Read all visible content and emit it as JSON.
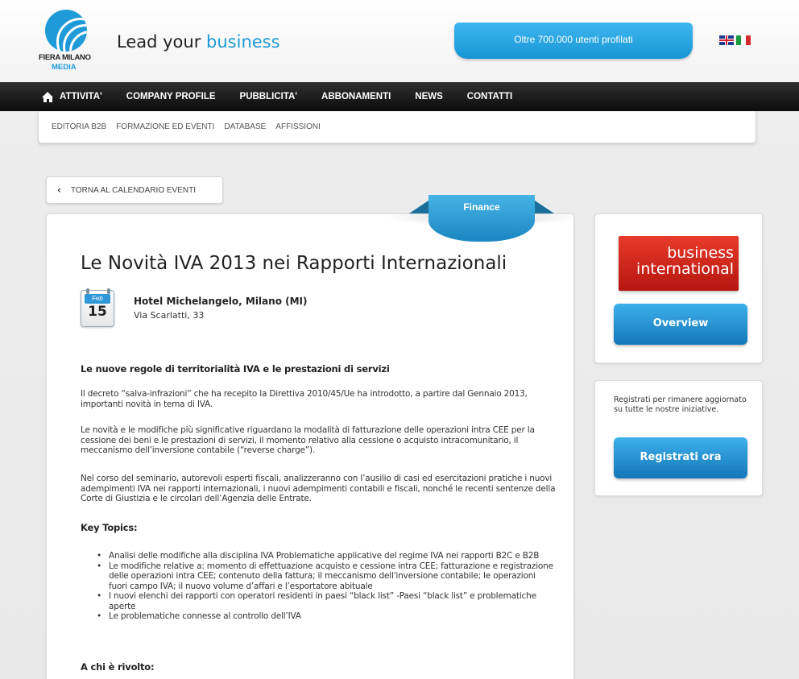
{
  "header": {
    "logo_line1": "FIERA MILANO",
    "logo_line2": "MEDIA",
    "tagline_main": "Lead your ",
    "tagline_accent": "business",
    "users_banner": "Oltre 700.000 utenti profilati",
    "languages": [
      "en-flag",
      "it-flag"
    ]
  },
  "nav": {
    "items": [
      "ATTIVITA'",
      "COMPANY PROFILE",
      "PUBBLICITA'",
      "ABBONAMENTI",
      "NEWS",
      "CONTATTI"
    ]
  },
  "subnav": {
    "items": [
      "EDITORIA B2B",
      "FORMAZIONE ED EVENTI",
      "DATABASE",
      "AFFISSIONI"
    ]
  },
  "back_button": "TORNA AL CALENDARIO EVENTI",
  "event": {
    "category": "Finance",
    "title": "Le Novità IVA 2013 nei Rapporti Internazionali",
    "month": "Feb",
    "day": "15",
    "venue": "Hotel Michelangelo, Milano (MI)",
    "address": "Via Scarlatti, 33"
  },
  "content": {
    "heading1": "Le nuove regole di territorialità IVA e le prestazioni di servizi",
    "para1": "Il decreto “salva-infrazioni” che ha recepito la Direttiva 2010/45/Ue ha introdotto, a partire dal Gennaio 2013, importanti novità in tema di IVA.",
    "para2": "Le novità e le modifiche più significative riguardano la modalità di fatturazione delle operazioni intra CEE per la cessione dei beni e le prestazioni di servizi, il momento relativo alla cessione o acquisto intracomunitario, il meccanismo dell’inversione contabile (“reverse charge”).",
    "para3": "Nel corso del seminario, autorevoli esperti fiscali, analizzeranno con l’ausilio di casi ed esercitazioni pratiche i nuovi adempimenti IVA nei rapporti internazionali, i nuovi adempimenti contabili e fiscali, nonché le recenti sentenze della Corte di Giustizia e le circolari dell’Agenzia delle Entrate.",
    "key_topics_heading": "Key Topics:",
    "topics": [
      "Analisi delle modifiche alla disciplina IVA Problematiche applicative del regime IVA nei rapporti B2C e B2B",
      "Le modifiche relative a: momento di effettuazione acquisto e cessione intra CEE; fatturazione e registrazione delle operazioni intra CEE; contenuto della fattura; il meccanismo dell'inversione contabile; le operazioni fuori campo IVA; il nuovo volume d’affari e l’esportatore abituale",
      "I nuovi elenchi dei rapporti con operatori residenti in paesi “black list” -Paesi “black list” e problematiche aperte",
      "Le problematiche connesse al controllo dell’IVA"
    ],
    "audience_heading": "A chi è rivolto:"
  },
  "sidebar": {
    "brand_line1": "business",
    "brand_line2": "international",
    "overview_button": "Overview",
    "register_text": "Registrati per rimanere aggiornato su tutte le nostre iniziative.",
    "register_button": "Registrati ora"
  },
  "colors": {
    "accent": "#1e9ad8",
    "nav_bg": "#111111",
    "brand_red": "#d0271c"
  }
}
